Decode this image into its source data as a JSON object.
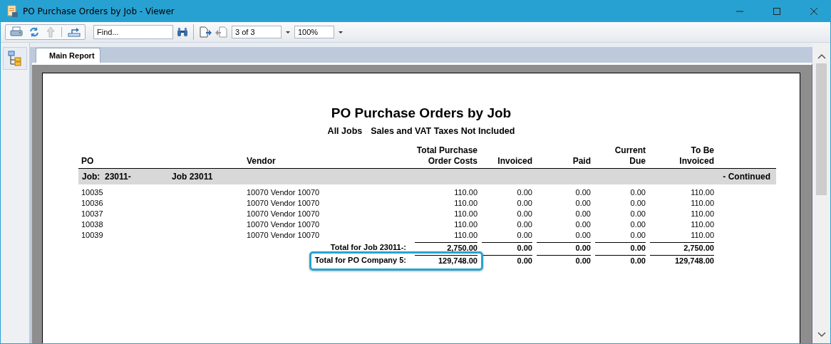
{
  "window": {
    "title": "PO Purchase Orders by Job - Viewer"
  },
  "toolbar": {
    "find": {
      "placeholder": "Find..."
    },
    "page": "3 of 3",
    "zoom": "100%"
  },
  "tabs": [
    {
      "label": "Main Report",
      "selected": true
    }
  ],
  "report": {
    "title": "PO Purchase Orders by Job",
    "subtitle": [
      "All Jobs",
      "Sales and VAT Taxes Not Included"
    ],
    "columns": [
      "PO",
      "Vendor",
      "Total Purchase\nOrder Costs",
      "Invoiced",
      "Paid",
      "Current\nDue",
      "To Be\nInvoiced"
    ],
    "group": {
      "label": "Job:  23011-",
      "name": "Job 23011",
      "note": "- Continued"
    },
    "rows": [
      {
        "po": "10035",
        "vendor": "10070 Vendor 10070",
        "values": [
          "110.00",
          "0.00",
          "0.00",
          "0.00",
          "110.00"
        ]
      },
      {
        "po": "10036",
        "vendor": "10070 Vendor 10070",
        "values": [
          "110.00",
          "0.00",
          "0.00",
          "0.00",
          "110.00"
        ]
      },
      {
        "po": "10037",
        "vendor": "10070 Vendor 10070",
        "values": [
          "110.00",
          "0.00",
          "0.00",
          "0.00",
          "110.00"
        ]
      },
      {
        "po": "10038",
        "vendor": "10070 Vendor 10070",
        "values": [
          "110.00",
          "0.00",
          "0.00",
          "0.00",
          "110.00"
        ]
      },
      {
        "po": "10039",
        "vendor": "10070 Vendor 10070",
        "values": [
          "110.00",
          "0.00",
          "0.00",
          "0.00",
          "110.00"
        ]
      }
    ],
    "totals": [
      {
        "label": "Total for Job 23011-:",
        "values": [
          "2,750.00",
          "0.00",
          "0.00",
          "0.00",
          "2,750.00"
        ],
        "highlighted": false
      },
      {
        "label": "Total for PO Company 5:",
        "values": [
          "129,748.00",
          "0.00",
          "0.00",
          "0.00",
          "129,748.00"
        ],
        "highlighted": true
      }
    ]
  }
}
